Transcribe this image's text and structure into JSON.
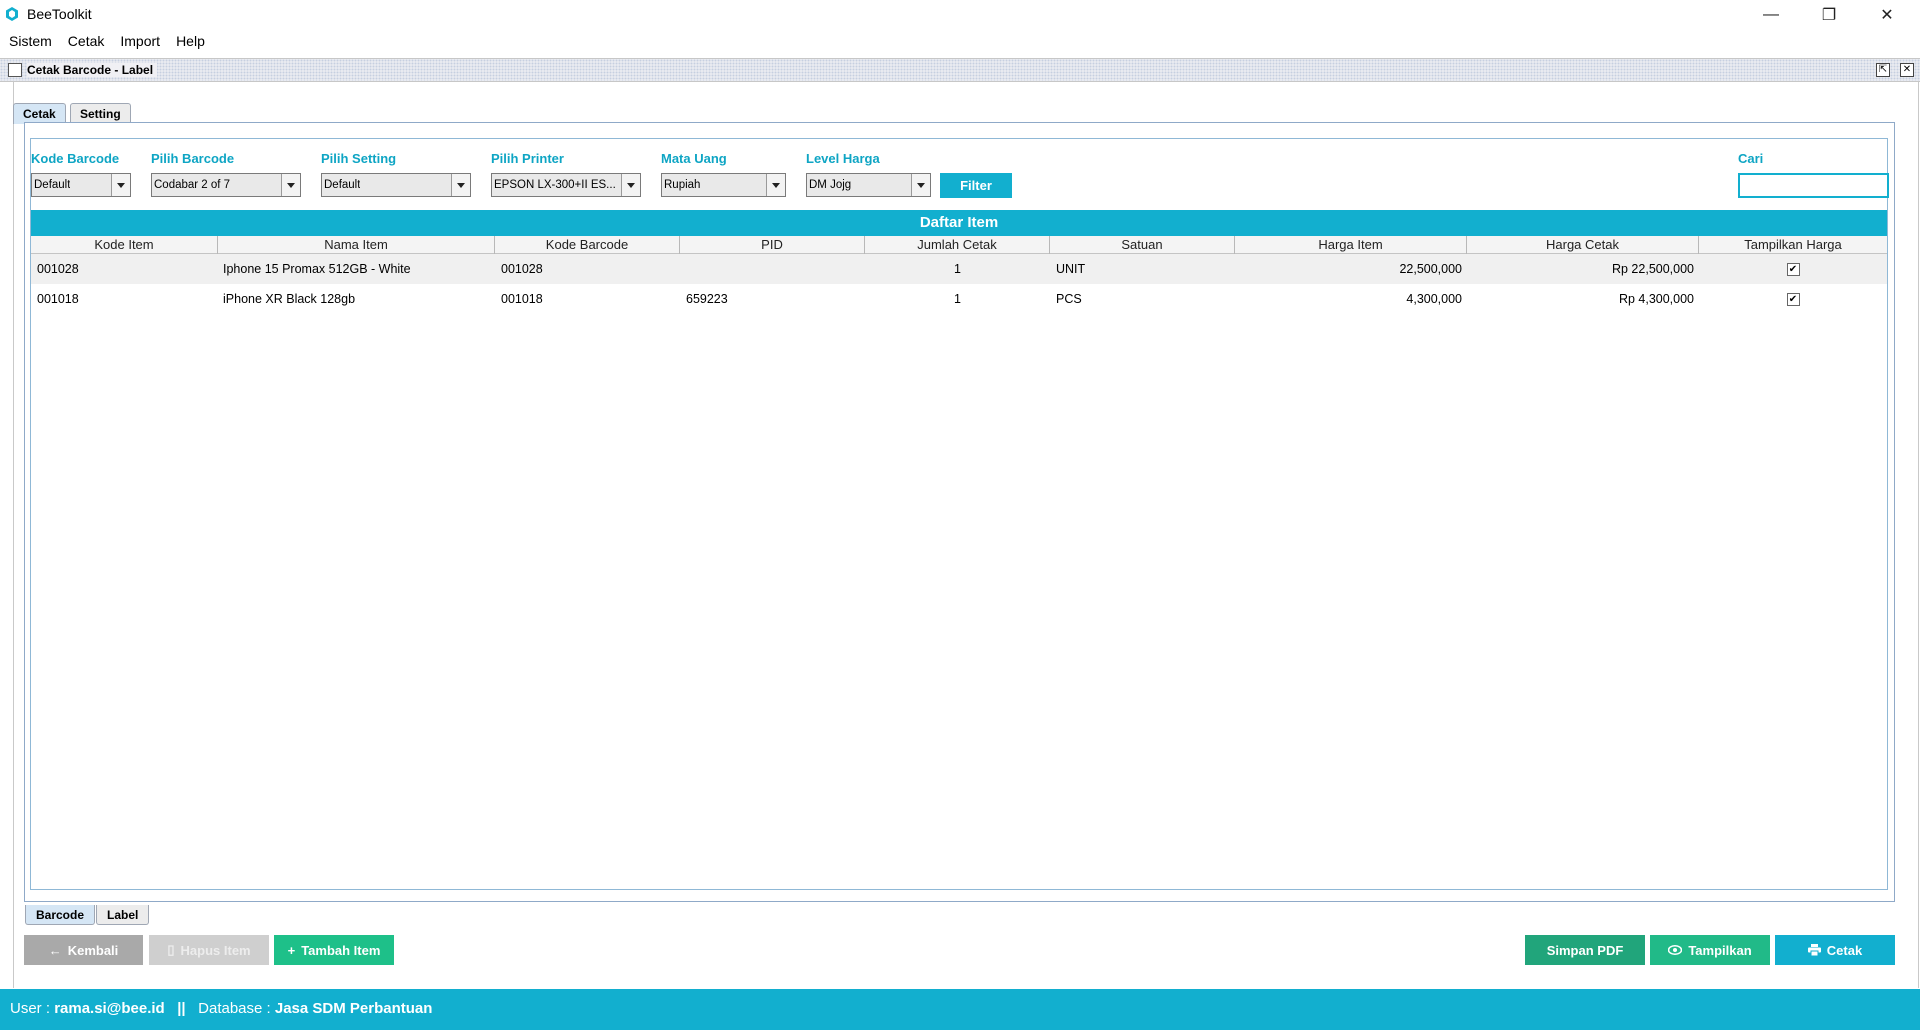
{
  "window": {
    "title": "BeeToolkit",
    "minimize_glyph": "—",
    "maximize_glyph": "❐",
    "close_glyph": "✕"
  },
  "menu": [
    "Sistem",
    "Cetak",
    "Import",
    "Help"
  ],
  "frame": {
    "title": "Cetak Barcode - Label"
  },
  "tabs": {
    "top": [
      "Cetak",
      "Setting"
    ],
    "bottom": [
      "Barcode",
      "Label"
    ]
  },
  "filters": {
    "kode_barcode": {
      "label": "Kode Barcode",
      "value": "Default"
    },
    "pilih_barcode": {
      "label": "Pilih Barcode",
      "value": "Codabar 2 of 7"
    },
    "pilih_setting": {
      "label": "Pilih Setting",
      "value": "Default"
    },
    "pilih_printer": {
      "label": "Pilih Printer",
      "value": "EPSON LX-300+II ES..."
    },
    "mata_uang": {
      "label": "Mata Uang",
      "value": "Rupiah"
    },
    "level_harga": {
      "label": "Level Harga",
      "value": "DM Jojg"
    },
    "filter_button": "Filter",
    "cari": {
      "label": "Cari",
      "value": ""
    }
  },
  "table": {
    "title": "Daftar Item",
    "columns": [
      "Kode Item",
      "Nama Item",
      "Kode Barcode",
      "PID",
      "Jumlah Cetak",
      "Satuan",
      "Harga Item",
      "Harga Cetak",
      "Tampilkan Harga"
    ],
    "rows": [
      [
        "001028",
        "Iphone 15 Promax 512GB - White",
        "001028",
        "",
        "1",
        "UNIT",
        "22,500,000",
        "Rp 22,500,000",
        "✔"
      ],
      [
        "001018",
        "iPhone XR Black 128gb",
        "001018",
        "659223",
        "1",
        "PCS",
        "4,300,000",
        "Rp 4,300,000",
        "✔"
      ]
    ]
  },
  "buttons": {
    "kembali": "Kembali",
    "hapus_item": "Hapus Item",
    "tambah_item": "Tambah Item",
    "simpan_pdf": "Simpan PDF",
    "tampilkan": "Tampilkan",
    "cetak": "Cetak"
  },
  "status": {
    "user_label": "User :",
    "user": "rama.si@bee.id",
    "separator": "||",
    "database_label": "Database :",
    "database": "Jasa SDM Perbantuan"
  },
  "colors": {
    "accent": "#12afcf",
    "green": "#21ba88",
    "disabled": "#a9a9a9"
  }
}
